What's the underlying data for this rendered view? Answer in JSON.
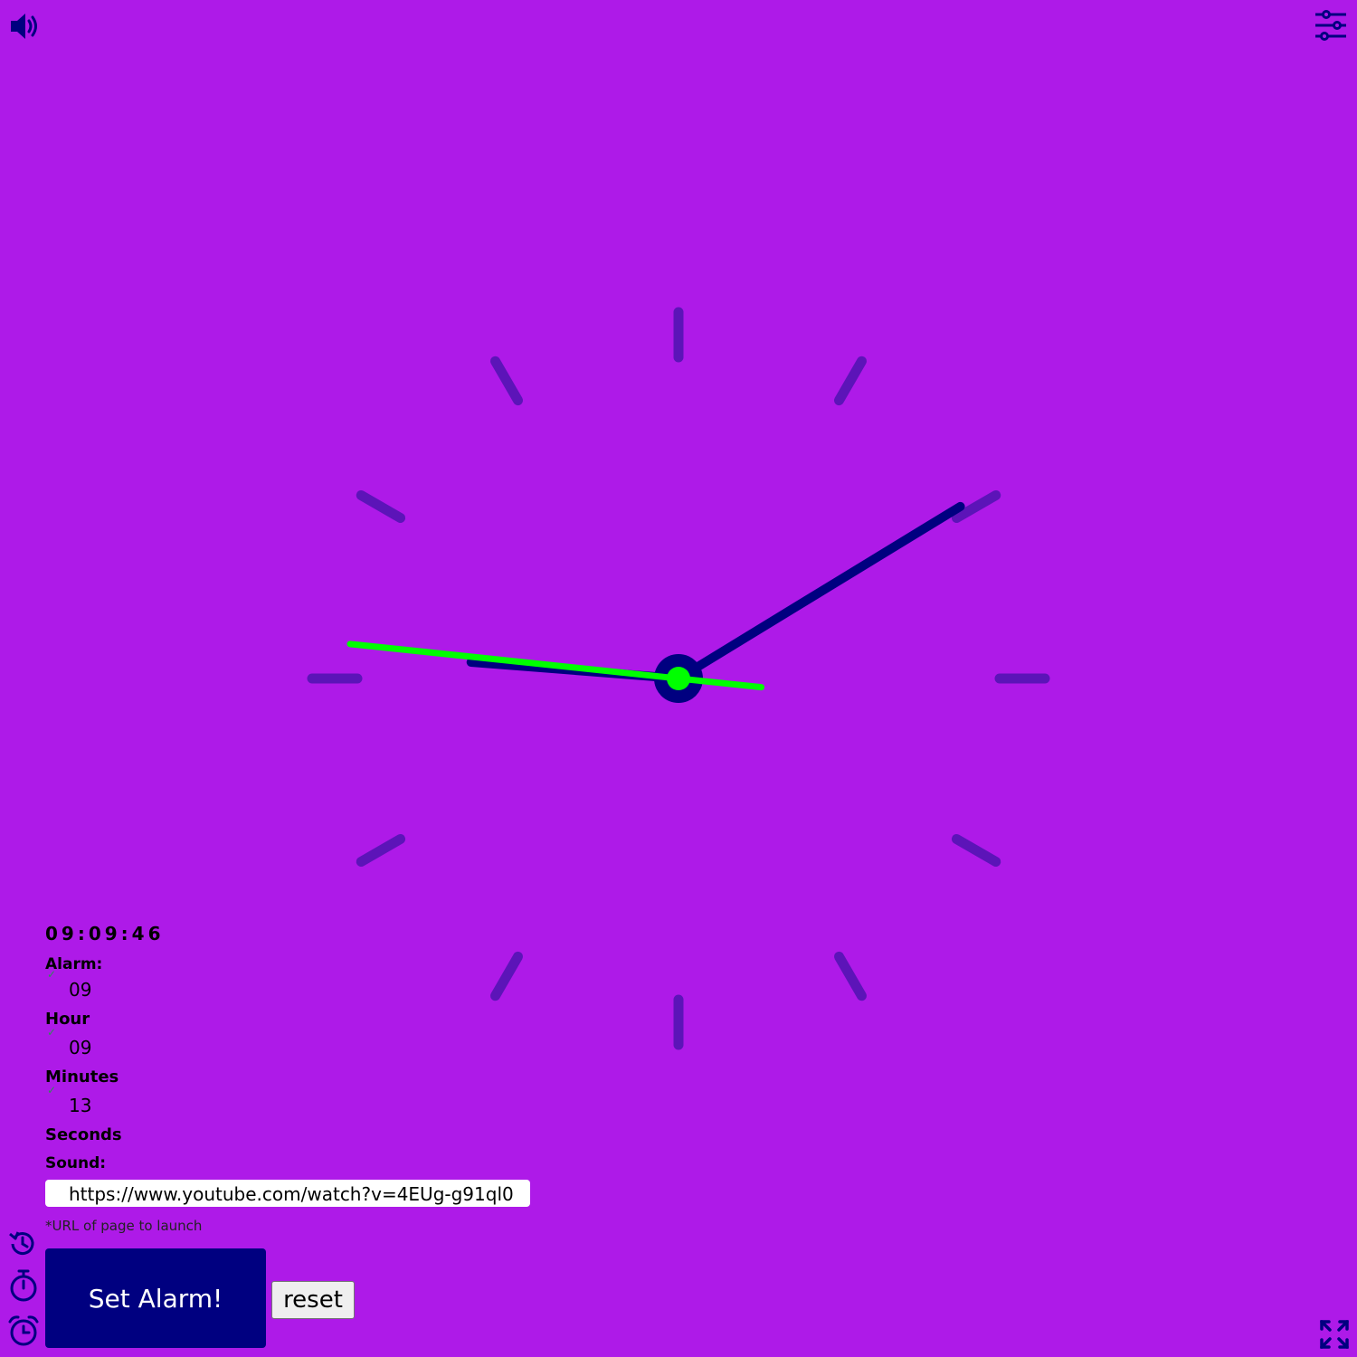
{
  "clock": {
    "time": "09:09:46",
    "hours": 9,
    "minutes": 9,
    "seconds": 46,
    "colors": {
      "background": "#ae1ae8",
      "ticks": "#5c14b8",
      "hour_minute_hands": "#000080",
      "second_hand": "#00ff00"
    }
  },
  "alarm": {
    "title": "Alarm:",
    "hour_value": "09",
    "hour_label": "Hour",
    "minutes_value": "09",
    "minutes_label": "Minutes",
    "seconds_value": "13",
    "seconds_label": "Seconds",
    "sound_label": "Sound:",
    "sound_url": "https://www.youtube.com/watch?v=4EUg-g91ql0",
    "hint": "*URL of page to launch",
    "set_label": "Set Alarm!",
    "reset_label": "reset"
  },
  "icons": {
    "top_left": "volume-icon",
    "top_right": "settings-sliders-icon",
    "left_bar": [
      "history-icon",
      "stopwatch-icon",
      "alarm-clock-icon"
    ],
    "bottom_right": "fullscreen-icon"
  }
}
